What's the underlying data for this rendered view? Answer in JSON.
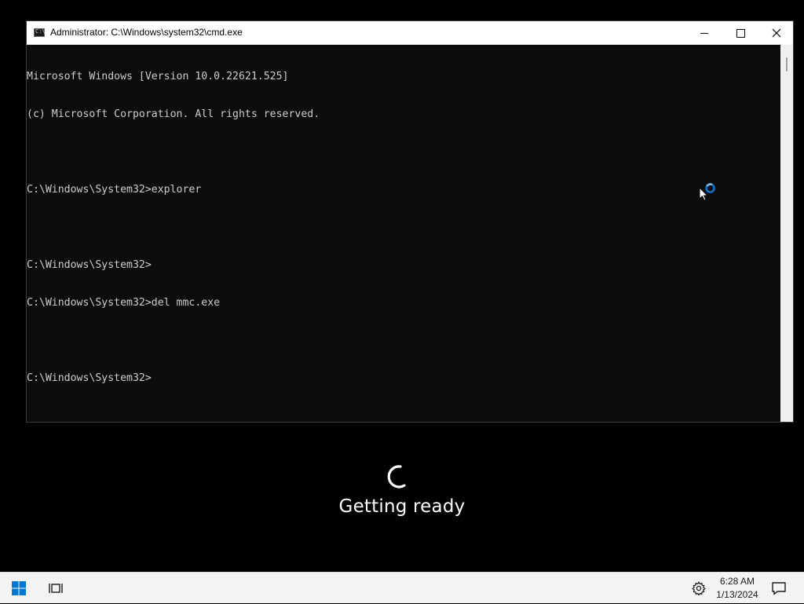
{
  "window": {
    "title": "Administrator: C:\\Windows\\system32\\cmd.exe",
    "icon": "cmd-icon",
    "controls": [
      "minimize-icon",
      "maximize-icon",
      "close-icon"
    ]
  },
  "console": {
    "lines": [
      "Microsoft Windows [Version 10.0.22621.525]",
      "(c) Microsoft Corporation. All rights reserved.",
      "",
      "C:\\Windows\\System32>explorer",
      "",
      "C:\\Windows\\System32>",
      "C:\\Windows\\System32>del mmc.exe",
      "",
      "C:\\Windows\\System32>"
    ],
    "text_color": "#cccccc",
    "background": "#0c0c0c"
  },
  "cursor": {
    "type": "busy-cursor-icon",
    "accent": "#0078d4"
  },
  "status": {
    "spinner": "spinner-icon",
    "message": "Getting ready"
  },
  "taskbar": {
    "start_icon": "windows-logo-icon",
    "task_view_icon": "task-view-icon",
    "settings_icon": "gear-icon",
    "notifications_icon": "notification-icon",
    "clock": {
      "time": "6:28 AM",
      "date": "1/13/2024"
    },
    "accent": "#0078d4"
  }
}
